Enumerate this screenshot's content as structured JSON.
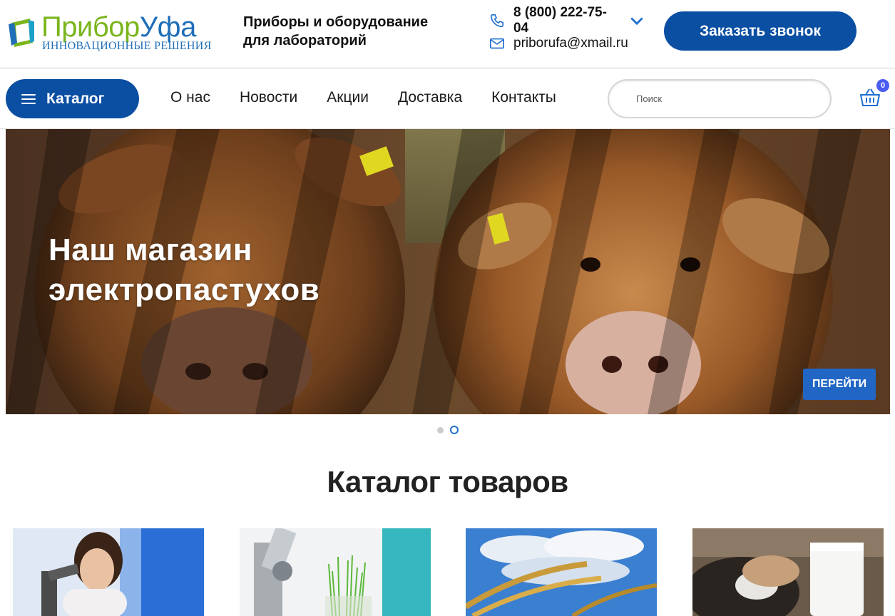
{
  "header": {
    "logo_word_1": "Прибор",
    "logo_word_2": "Уфа",
    "logo_subtitle": "ИННОВАЦИОННЫЕ РЕШЕНИЯ",
    "tagline_line1": "Приборы и оборудование",
    "tagline_line2": "для лабораторий",
    "phone": "8 (800) 222-75-04",
    "email": "priborufa@xmail.ru",
    "callback_label": "Заказать звонок"
  },
  "nav": {
    "catalog_label": "Каталог",
    "links": [
      "О нас",
      "Новости",
      "Акции",
      "Доставка",
      "Контакты"
    ],
    "search_placeholder": "Поиск",
    "cart_count": "0"
  },
  "hero": {
    "title_line1": "Наш магазин",
    "title_line2": "электропастухов",
    "button_label": "ПЕРЕЙТИ",
    "slides_total": 2,
    "active_slide": 2
  },
  "catalog": {
    "title": "Каталог товаров"
  },
  "colors": {
    "brand_blue": "#0b4fa3",
    "brand_green": "#7ab51d",
    "hero_button": "#2166c4",
    "badge": "#4b5cf0"
  },
  "icons": {
    "phone": "phone-icon",
    "mail": "mail-icon",
    "chevron": "chevron-down-icon",
    "menu": "menu-icon",
    "cart": "basket-icon"
  }
}
